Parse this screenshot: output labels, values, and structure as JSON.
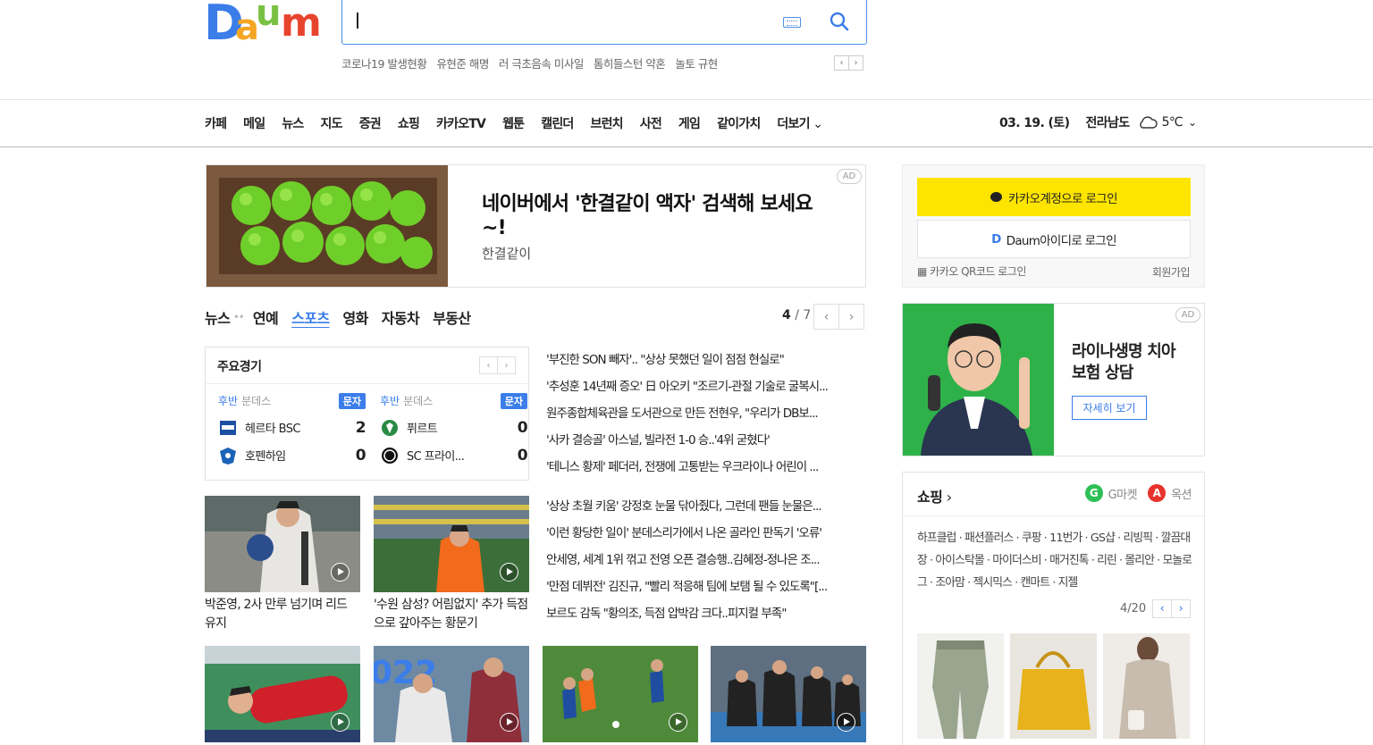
{
  "header": {
    "logo_text": "Daum",
    "search": {
      "value": "",
      "placeholder": ""
    },
    "trending": [
      "코로나19 발생현황",
      "유현준 해명",
      "러 극초음속 미사일",
      "톰히들스턴 약혼",
      "놀토 규현"
    ]
  },
  "nav": {
    "items": [
      "카페",
      "메일",
      "뉴스",
      "지도",
      "증권",
      "쇼핑",
      "카카오TV",
      "웹툰",
      "캘린더",
      "브런치",
      "사전",
      "게임",
      "같이가치"
    ],
    "more": "더보기"
  },
  "weather": {
    "date": "03. 19. (토)",
    "region": "전라남도",
    "temp": "5℃",
    "icon": "cloud-icon"
  },
  "ad_banner": {
    "title": "네이버에서 '한결같이 액자' 검색해 보세요~!",
    "subtitle": "한결같이",
    "badge": "AD"
  },
  "news": {
    "tabs": [
      "뉴스",
      "연예",
      "스포츠",
      "영화",
      "자동차",
      "부동산"
    ],
    "active_tab": "스포츠",
    "page_current": "4",
    "page_total": "/ 7",
    "scoreboard": {
      "title": "주요경기",
      "matches": [
        {
          "half": "후반",
          "league": "분데스",
          "live": "문자",
          "home": {
            "name": "헤르타 BSC",
            "score": "2"
          },
          "away": {
            "name": "호펜하임",
            "score": "0"
          }
        },
        {
          "half": "후반",
          "league": "분데스",
          "live": "문자",
          "home": {
            "name": "퓌르트",
            "score": "0"
          },
          "away": {
            "name": "SC 프라이...",
            "score": "0"
          }
        }
      ]
    },
    "headlines": [
      "'부진한 SON 빼자'.. \"상상 못했던 일이 점점 현실로\"",
      "'추성훈 14년째 증오' 日 아오키 \"조르기-관절 기술로 굴복시...",
      "원주종합체육관을 도서관으로 만든 전현우, \"우리가 DB보...",
      "'사카 결승골' 아스널, 빌라전 1-0 승..'4위 굳혔다'",
      "'테니스 황제' 페더러, 전쟁에 고통받는 우크라이나 어린이 ...",
      "'상상 초월 키움' 강정호 눈물 닦아줬다, 그런데 팬들 눈물은...",
      "'이런 황당한 일이' 분데스리가에서 나온 골라인 판독기 '오류'",
      "안세영, 세계 1위 꺾고 전영 오픈 결승행..김혜정-정나은 조...",
      "'만점 데뷔전' 김진규, \"빨리 적응해 팀에 보탬 될 수 있도록\"[...",
      "보르도 감독 \"황의조, 득점 압박감 크다..피지컬 부족\""
    ],
    "thumbs": [
      {
        "caption": "박준영, 2사 만루 넘기며 리드 유지"
      },
      {
        "caption": "'수원 삼성? 어림없지' 추가 득점으로 갚아주는 황문기"
      }
    ]
  },
  "login": {
    "kakao_label": "카카오계정으로 로그인",
    "daum_label": "Daum아이디로 로그인",
    "qr_label": "카카오 QR코드 로그인",
    "signup_label": "회원가입"
  },
  "ad_side": {
    "title": "라이나생명 치아보험 상담",
    "button": "자세히 보기",
    "badge": "AD"
  },
  "shopping": {
    "title": "쇼핑",
    "partners": [
      "G마켓",
      "옥션"
    ],
    "links": "하프클럽 · 패션플러스 · 쿠팡 · 11번가 · GS샵 · 리빙픽 · 깔끔대장 · 아이스탁몰 · 마이더스비 · 매거진톡 · 리린 · 몰리안 · 모놀로그 · 조아맘 · 젝시믹스 · 캔마트 · 지젤",
    "page": "4/20"
  }
}
